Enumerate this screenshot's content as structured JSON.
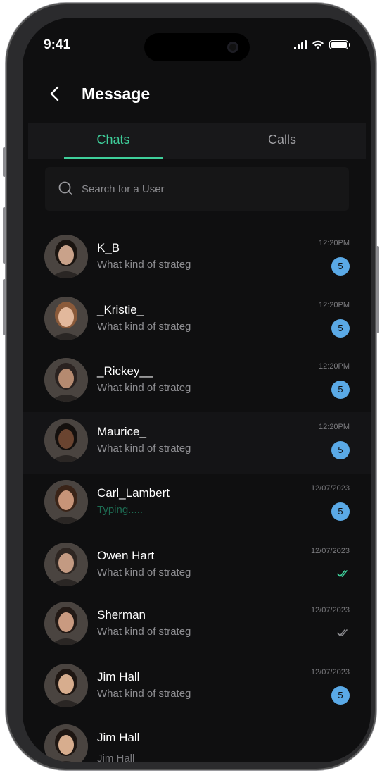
{
  "status_bar": {
    "time": "9:41"
  },
  "header": {
    "title": "Message"
  },
  "tabs": [
    {
      "label": "Chats",
      "active": true
    },
    {
      "label": "Calls",
      "active": false
    }
  ],
  "search": {
    "placeholder": "Search for a User",
    "value": ""
  },
  "colors": {
    "accent": "#3fcf9b",
    "badge": "#5aa9e6",
    "background": "#0f0f10"
  },
  "chats": [
    {
      "name": "K_B",
      "preview": "What kind of strateg",
      "time": "12:20PM",
      "badge": "5",
      "status": "unread",
      "avatar_tone": "#c9a28a",
      "hair": "#1a1410"
    },
    {
      "name": "_Kristie_",
      "preview": "What kind of strateg",
      "time": "12:20PM",
      "badge": "5",
      "status": "unread",
      "avatar_tone": "#e2b89c",
      "hair": "#8a5a3a"
    },
    {
      "name": "_Rickey__",
      "preview": "What kind of strateg",
      "time": "12:20PM",
      "badge": "5",
      "status": "unread",
      "avatar_tone": "#b58a70",
      "hair": "#2a2220"
    },
    {
      "name": "Maurice_",
      "preview": "What kind of strateg",
      "time": "12:20PM",
      "badge": "5",
      "status": "unread",
      "avatar_tone": "#6a4430",
      "hair": "#14100e"
    },
    {
      "name": "Carl_Lambert",
      "preview": "Typing.....",
      "time": "12/07/2023",
      "badge": "5",
      "status": "typing",
      "avatar_tone": "#c79478",
      "hair": "#3a2418"
    },
    {
      "name": "Owen Hart",
      "preview": "What kind of strateg",
      "time": "12/07/2023",
      "badge": "",
      "status": "read",
      "avatar_tone": "#c39a82",
      "hair": "#2e2622"
    },
    {
      "name": "Sherman",
      "preview": "What kind of strateg",
      "time": "12/07/2023",
      "badge": "",
      "status": "delivered",
      "avatar_tone": "#c99a80",
      "hair": "#231a16"
    },
    {
      "name": "Jim Hall",
      "preview": "What kind of strateg",
      "time": "12/07/2023",
      "badge": "5",
      "status": "unread",
      "avatar_tone": "#d7ad8e",
      "hair": "#1e1612"
    },
    {
      "name": "Jim Hall",
      "preview": "Jim Hall",
      "time": "",
      "badge": "",
      "status": "none",
      "avatar_tone": "#d7ad8e",
      "hair": "#1e1612"
    }
  ]
}
